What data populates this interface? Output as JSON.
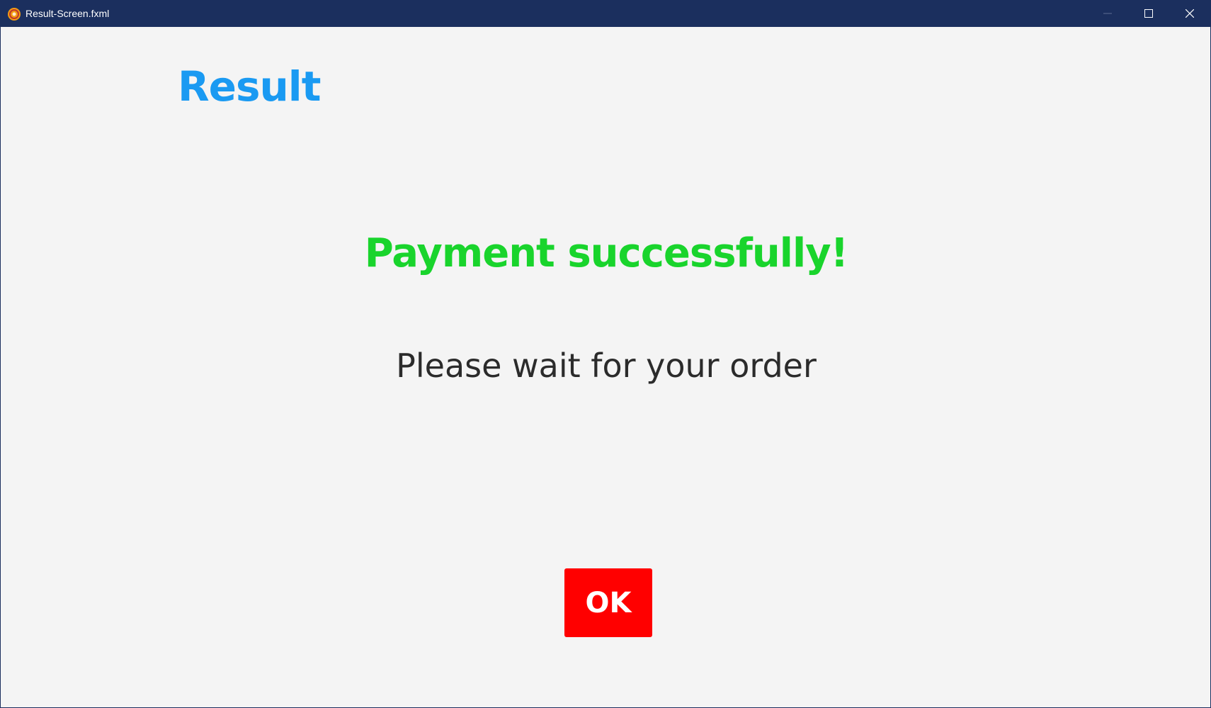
{
  "window": {
    "title": "Result-Screen.fxml",
    "icon": "app-icon",
    "controls": {
      "minimize_icon": "minimize-icon",
      "maximize_icon": "maximize-icon",
      "close_icon": "close-icon"
    }
  },
  "main": {
    "heading": "Result",
    "success_message": "Payment successfully!",
    "wait_message": "Please wait for your order",
    "ok_label": "OK"
  },
  "colors": {
    "titlebar": "#1b2f5e",
    "heading": "#1a9af2",
    "success": "#19d42c",
    "body_text": "#2b2b2b",
    "ok_button": "#ff0000",
    "background": "#f4f4f4"
  }
}
